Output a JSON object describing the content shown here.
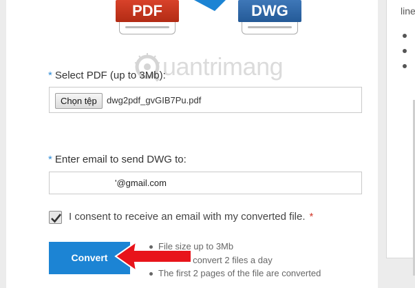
{
  "icons": {
    "pdf_label": "PDF",
    "dwg_label": "DWG"
  },
  "watermark": {
    "text": "uantrimang"
  },
  "side_panel": {
    "text": "line"
  },
  "form": {
    "pdf_label": "Select PDF (up to 3Mb):",
    "file_button": "Chọn tệp",
    "file_name": "dwg2pdf_gvGIB7Pu.pdf",
    "email_label": "Enter email to send DWG to:",
    "email_value": "'@gmail.com",
    "required_mark": "*",
    "consent_text": "I consent to receive an email with my converted file.",
    "consent_checked": true,
    "convert_label": "Convert"
  },
  "notes": [
    "File size up to 3Mb",
    "You can convert 2 files a day",
    "The first 2 pages of the file are converted"
  ],
  "colors": {
    "accent": "#1c84d4",
    "pdf_red": "#c9341c",
    "dwg_blue": "#2f68a8",
    "arrow_red": "#e8141b"
  }
}
